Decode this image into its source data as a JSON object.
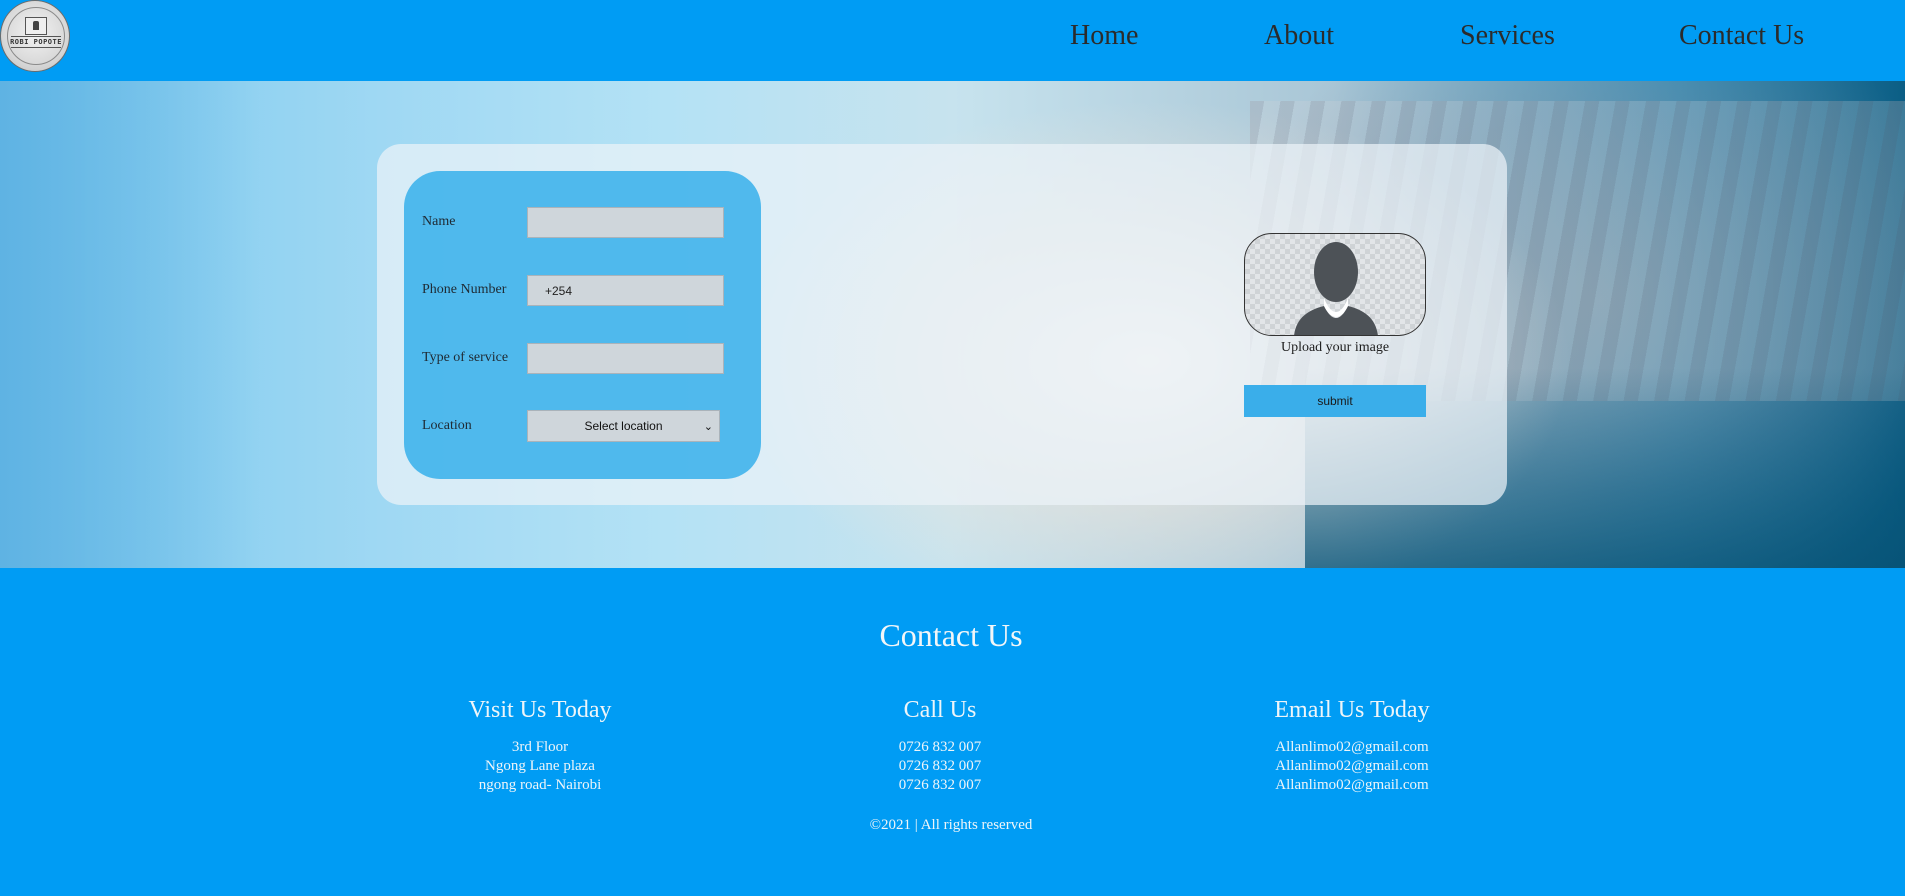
{
  "logo": {
    "text": "ROBI POPOTE",
    "icon": "brand-seal-icon"
  },
  "nav": {
    "items": [
      {
        "label": "Home"
      },
      {
        "label": "About"
      },
      {
        "label": "Services"
      },
      {
        "label": "Contact Us"
      }
    ]
  },
  "form": {
    "fields": {
      "name": {
        "label": "Name",
        "value": ""
      },
      "phone": {
        "label": "Phone Number",
        "value": "+254"
      },
      "service": {
        "label": "Type of service",
        "value": ""
      },
      "location": {
        "label": "Location",
        "selected": "Select location"
      }
    },
    "upload": {
      "label": "Upload your image",
      "icon": "user-avatar-icon"
    },
    "submit_label": "submit"
  },
  "contact": {
    "title": "Contact Us",
    "visit": {
      "heading": "Visit Us Today",
      "lines": [
        "3rd Floor",
        "Ngong Lane plaza",
        "ngong road- Nairobi"
      ]
    },
    "call": {
      "heading": "Call Us",
      "lines": [
        "0726 832 007",
        "0726 832 007",
        "0726 832 007"
      ]
    },
    "email": {
      "heading": "Email Us Today",
      "lines": [
        "Allanlimo02@gmail.com",
        "Allanlimo02@gmail.com",
        "Allanlimo02@gmail.com"
      ]
    },
    "copyright": "©2021 | All rights reserved"
  },
  "colors": {
    "primary": "#009cf4",
    "panel": "#28aaeb",
    "submit": "#3aaeea"
  }
}
